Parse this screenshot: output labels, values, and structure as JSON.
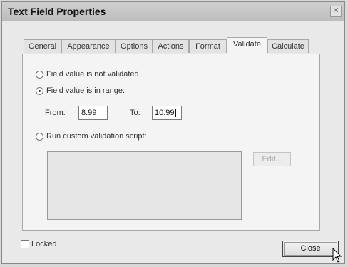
{
  "window": {
    "title": "Text Field Properties",
    "close_glyph": "✕"
  },
  "tabs": [
    {
      "label": "General"
    },
    {
      "label": "Appearance"
    },
    {
      "label": "Options"
    },
    {
      "label": "Actions"
    },
    {
      "label": "Format"
    },
    {
      "label": "Validate",
      "active": true
    },
    {
      "label": "Calculate"
    }
  ],
  "validate": {
    "option_not_validated": "Field value is not validated",
    "option_in_range": "Field value is in range:",
    "from_label": "From:",
    "from_value": "8.99",
    "to_label": "To:",
    "to_value": "10.99",
    "option_custom_script": "Run custom validation script:",
    "selected_option": "in_range",
    "script_text": "",
    "edit_button": "Edit..."
  },
  "footer": {
    "locked_label": "Locked",
    "locked_checked": false,
    "close_button": "Close"
  },
  "icons": {
    "cursor": "mouse-pointer-icon"
  }
}
